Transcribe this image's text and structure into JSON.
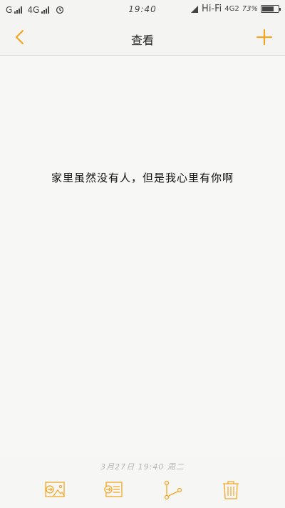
{
  "status_bar": {
    "carrier1": "G",
    "carrier2": "4G",
    "time": "19:40",
    "wifi_label": "Hi-Fi",
    "network_right": "4G2",
    "battery_text": "73%",
    "battery_level": 0.73
  },
  "header": {
    "title": "查看"
  },
  "note": {
    "text": "家里虽然没有人，但是我心里有你啊",
    "timestamp": "3月27日 19:40 周二"
  },
  "colors": {
    "accent": "#f5a623",
    "background": "#f7f7f5"
  },
  "icons": {
    "back": "chevron-left-icon",
    "add": "plus-icon",
    "image": "image-icon",
    "export": "export-icon",
    "share": "share-icon",
    "delete": "trash-icon"
  }
}
